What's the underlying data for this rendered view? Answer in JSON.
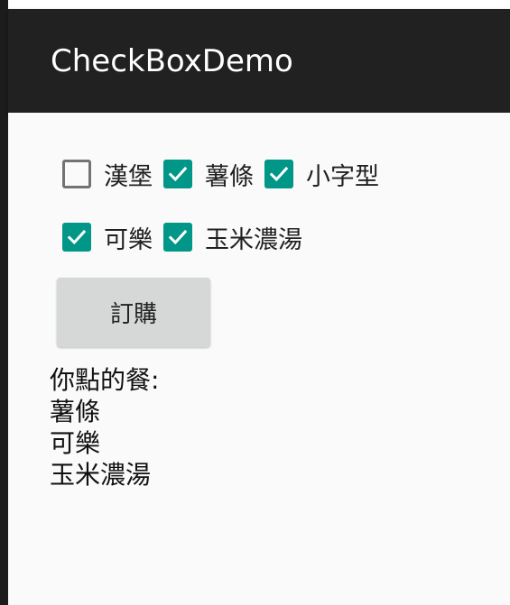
{
  "app_bar": {
    "title": "CheckBoxDemo",
    "background": "#212121"
  },
  "checkboxes": [
    {
      "label": "漢堡",
      "checked": false
    },
    {
      "label": "薯條",
      "checked": true
    },
    {
      "label": "小字型",
      "checked": true
    },
    {
      "label": "可樂",
      "checked": true
    },
    {
      "label": "玉米濃湯",
      "checked": true
    }
  ],
  "order_button": {
    "label": "訂購"
  },
  "result": {
    "header": "你點的餐:",
    "items": [
      "薯條",
      "可樂",
      "玉米濃湯"
    ]
  },
  "colors": {
    "accent": "#009688",
    "button": "#d6d7d7"
  },
  "icons": {
    "checkbox_mark": "check-icon"
  }
}
